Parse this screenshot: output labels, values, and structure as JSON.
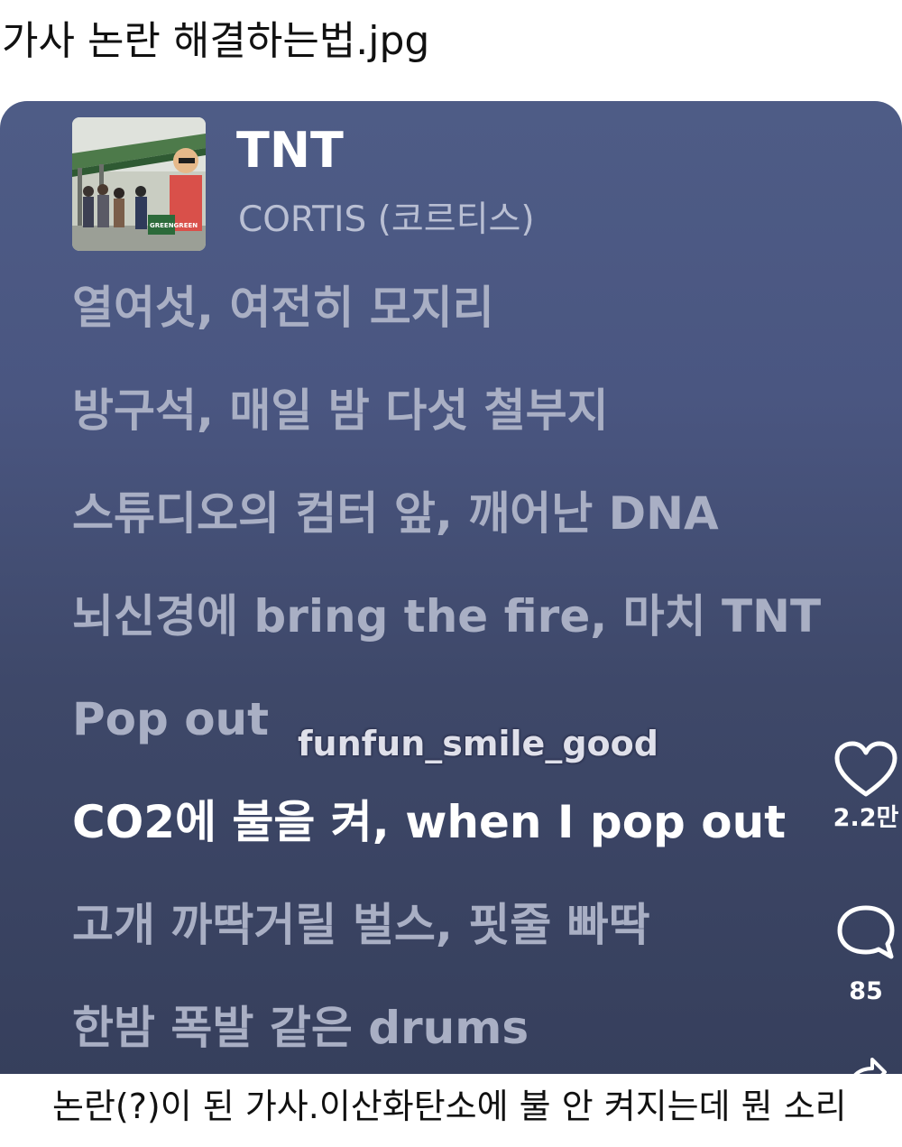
{
  "post": {
    "title": "가사 논란 해결하는법.jpg",
    "caption": "논란(?)이 된 가사.이산화탄소에 불 안 켜지는데 뭔 소리"
  },
  "song": {
    "title": "TNT",
    "artist": "CORTIS (코르티스)",
    "album_art_text": "GREENGREEN"
  },
  "lyrics": [
    "열여섯, 여전히 모지리",
    "방구석, 매일 밤 다섯 철부지",
    "스튜디오의 컴터 앞, 깨어난 DNA",
    "뇌신경에 bring the fire, 마치 TNT",
    "Pop out",
    "CO2에 불을 켜, when I pop out",
    "고개 까딱거릴 벌스, 핏줄 빠딱",
    "한밤 폭발 같은 drums"
  ],
  "active_lyric_index": 5,
  "watermark": "funfun_smile_good",
  "actions": {
    "like_icon": "heart-icon",
    "like_count": "2.2만",
    "comment_icon": "comment-bubble-icon",
    "comment_count": "85",
    "share_icon": "share-arrow-icon"
  },
  "colors": {
    "card_top": "#4e5c86",
    "card_bottom": "#363f5c",
    "lyric_inactive": "#a9afc4",
    "lyric_active": "#ffffff",
    "artist": "#b9bfd3"
  }
}
